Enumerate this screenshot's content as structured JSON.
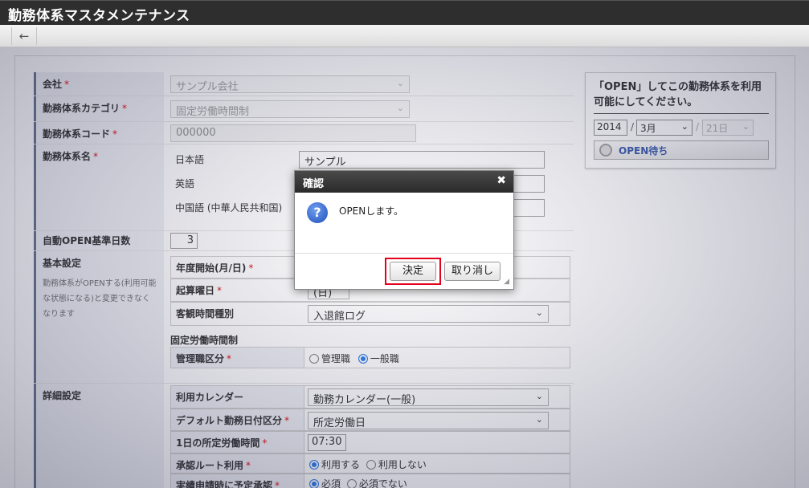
{
  "window": {
    "title": "勤務体系マスタメンテナンス"
  },
  "toolbar": {
    "back_icon": "←"
  },
  "form": {
    "company": {
      "label": "会社",
      "value": "サンプル会社"
    },
    "category": {
      "label": "勤務体系カテゴリ",
      "value": "固定労働時間制"
    },
    "code": {
      "label": "勤務体系コード",
      "value": "000000"
    },
    "name": {
      "label": "勤務体系名",
      "langs": [
        {
          "label": "日本語",
          "value": "サンプル"
        },
        {
          "label": "英語",
          "value": ""
        },
        {
          "label": "中国語 (中華人民共和国)",
          "value": ""
        }
      ]
    },
    "auto_open": {
      "label": "自動OPEN基準日数",
      "value": "3"
    },
    "basic": {
      "label": "基本設定",
      "note": "勤務体系がOPENする(利用可能な状態になる)と変更できなくなります",
      "fiscal_start": {
        "label": "年度開始(月/日)"
      },
      "week_start": {
        "label": "起算曜日",
        "value": "(日)"
      },
      "observe_type": {
        "label": "客観時間種別",
        "value": "入退館ログ"
      },
      "fixed_section": "固定労働時間制",
      "manager_class": {
        "label": "管理職区分",
        "opt1": "管理職",
        "opt2": "一般職",
        "selected": "一般職"
      }
    },
    "detail": {
      "label": "詳細設定",
      "calendar": {
        "label": "利用カレンダー",
        "value": "勤務カレンダー(一般)"
      },
      "default_date": {
        "label": "デフォルト勤務日付区分",
        "value": "所定労働日"
      },
      "daily_hours": {
        "label": "1日の所定労働時間",
        "value": "07:30"
      },
      "route": {
        "label": "承認ルート利用",
        "opt1": "利用する",
        "opt2": "利用しない",
        "selected": "利用する"
      },
      "pre_approval": {
        "label": "実績申請時に予定承認",
        "opt1": "必須",
        "opt2": "必須でない",
        "selected": "必須"
      }
    }
  },
  "side_panel": {
    "message": "「OPEN」してこの勤務体系を利用可能にしてください。",
    "year": "2014",
    "month": "3月",
    "day": "21日",
    "status": "OPEN待ち"
  },
  "dialog": {
    "title": "確認",
    "message": "OPENします。",
    "ok": "決定",
    "cancel": "取り消し"
  }
}
